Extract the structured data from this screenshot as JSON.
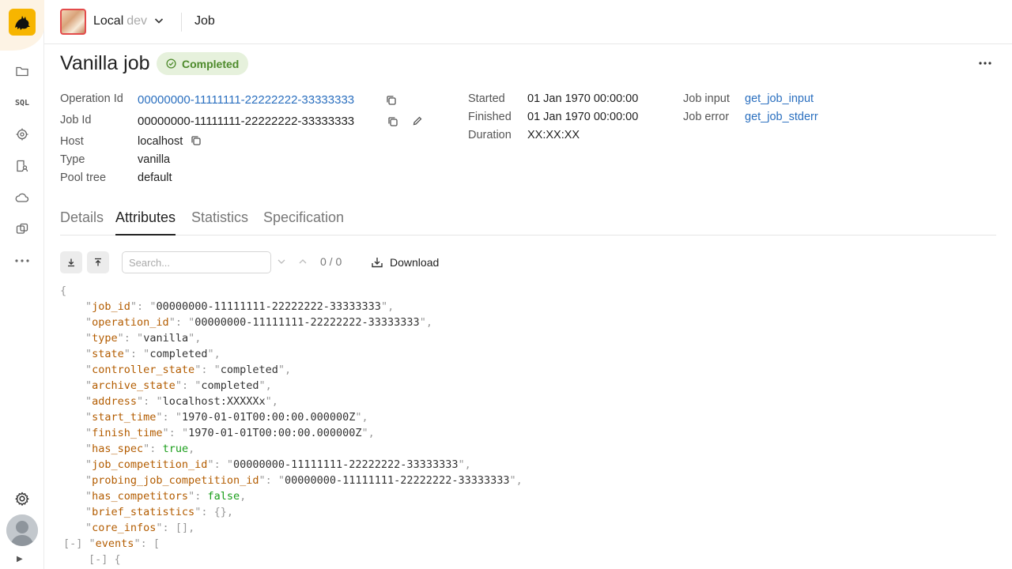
{
  "header": {
    "cluster_name": "Local",
    "cluster_env": "dev",
    "page_name": "Job"
  },
  "title": "Vanilla job",
  "status": "Completed",
  "meta": {
    "operation_id_label": "Operation Id",
    "operation_id": "00000000-11111111-22222222-33333333",
    "job_id_label": "Job Id",
    "job_id": "00000000-11111111-22222222-33333333",
    "host_label": "Host",
    "host": "localhost",
    "type_label": "Type",
    "type": "vanilla",
    "pool_tree_label": "Pool tree",
    "pool_tree": "default",
    "started_label": "Started",
    "started": "01 Jan 1970 00:00:00",
    "finished_label": "Finished",
    "finished": "01 Jan 1970 00:00:00",
    "duration_label": "Duration",
    "duration": "XX:XX:XX",
    "job_input_label": "Job input",
    "job_input": "get_job_input",
    "job_error_label": "Job error",
    "job_error": "get_job_stderr"
  },
  "tabs": [
    "Details",
    "Attributes",
    "Statistics",
    "Specification"
  ],
  "active_tab": "Attributes",
  "toolbar": {
    "search_placeholder": "Search...",
    "match_count": "0 / 0",
    "download_label": "Download"
  },
  "json": {
    "open_brace": "{",
    "lines": [
      {
        "key": "job_id",
        "value": "00000000-11111111-22222222-33333333",
        "kind": "string"
      },
      {
        "key": "operation_id",
        "value": "00000000-11111111-22222222-33333333",
        "kind": "string"
      },
      {
        "key": "type",
        "value": "vanilla",
        "kind": "string"
      },
      {
        "key": "state",
        "value": "completed",
        "kind": "string"
      },
      {
        "key": "controller_state",
        "value": "completed",
        "kind": "string"
      },
      {
        "key": "archive_state",
        "value": "completed",
        "kind": "string"
      },
      {
        "key": "address",
        "value": "localhost:XXXXXx",
        "kind": "string"
      },
      {
        "key": "start_time",
        "value": "1970-01-01T00:00:00.000000Z",
        "kind": "string"
      },
      {
        "key": "finish_time",
        "value": "1970-01-01T00:00:00.000000Z",
        "kind": "string"
      },
      {
        "key": "has_spec",
        "value": "true",
        "kind": "bool"
      },
      {
        "key": "job_competition_id",
        "value": "00000000-11111111-22222222-33333333",
        "kind": "string"
      },
      {
        "key": "probing_job_competition_id",
        "value": "00000000-11111111-22222222-33333333",
        "kind": "string"
      },
      {
        "key": "has_competitors",
        "value": "false",
        "kind": "bool"
      },
      {
        "key": "brief_statistics",
        "value": "{}",
        "kind": "empty"
      },
      {
        "key": "core_infos",
        "value": "[]",
        "kind": "empty"
      }
    ],
    "events_collapse": "[-]",
    "events_key": "events",
    "events_open": "[",
    "event_collapse": "[-]",
    "event_open": "{"
  }
}
